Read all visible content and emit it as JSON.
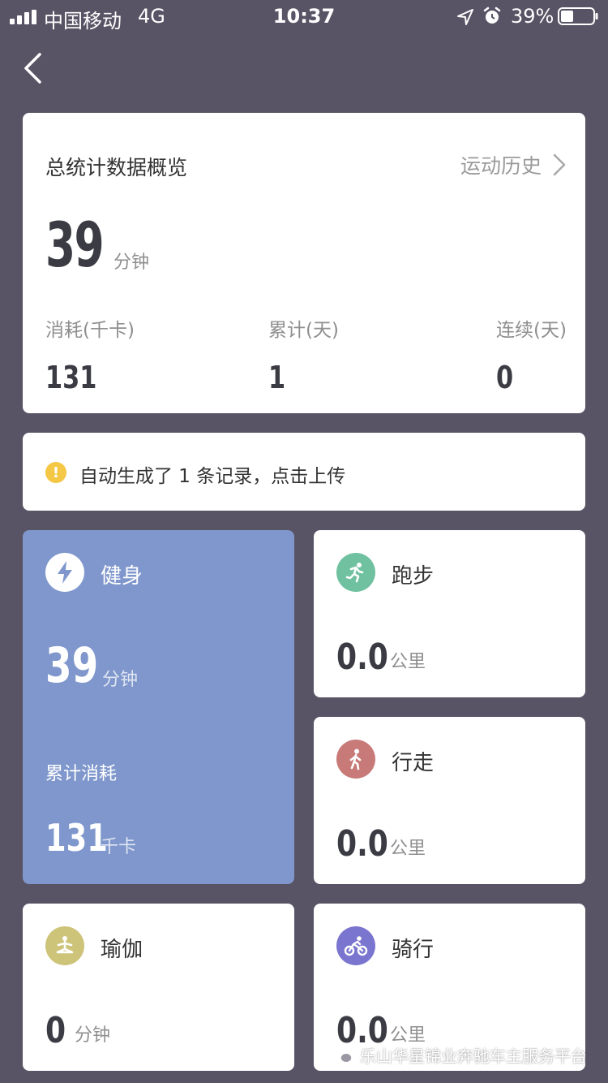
{
  "status_bar": {
    "carrier": "中国移动",
    "network": "4G",
    "time": "10:37",
    "battery": "39%",
    "battery_level": 0.39
  },
  "nav": {
    "back_icon": "chevron-left-icon"
  },
  "summary": {
    "title": "总统计数据概览",
    "history_label": "运动历史",
    "total_minutes": "39",
    "minutes_unit": "分钟",
    "stats": [
      {
        "label": "消耗(千卡)",
        "value": "131"
      },
      {
        "label": "累计(天)",
        "value": "1"
      },
      {
        "label": "连续(天)",
        "value": "0"
      }
    ]
  },
  "notice": {
    "icon": "warning-icon",
    "text": "自动生成了 1 条记录，点击上传"
  },
  "sports": {
    "fitness": {
      "name": "健身",
      "minutes": "39",
      "minutes_unit": "分钟",
      "total_label": "累计消耗",
      "calories": "131",
      "calories_unit": "千卡",
      "icon": "lightning-icon",
      "color": "#7f97cc"
    },
    "running": {
      "name": "跑步",
      "value": "0.0",
      "unit": "公里",
      "icon": "running-icon",
      "color": "#6fc1a0"
    },
    "walking": {
      "name": "行走",
      "value": "0.0",
      "unit": "公里",
      "icon": "walking-icon",
      "color": "#c77a78"
    },
    "yoga": {
      "name": "瑜伽",
      "value": "0",
      "unit": "分钟",
      "icon": "yoga-icon",
      "color": "#cdc47a"
    },
    "cycling": {
      "name": "骑行",
      "value": "0.0",
      "unit": "公里",
      "icon": "cycling-icon",
      "color": "#7a75cf"
    }
  },
  "watermark": {
    "text": "乐山华星锦业奔驰车主服务平台"
  },
  "colors": {
    "background": "#595465",
    "accent_warning": "#f4c744"
  }
}
